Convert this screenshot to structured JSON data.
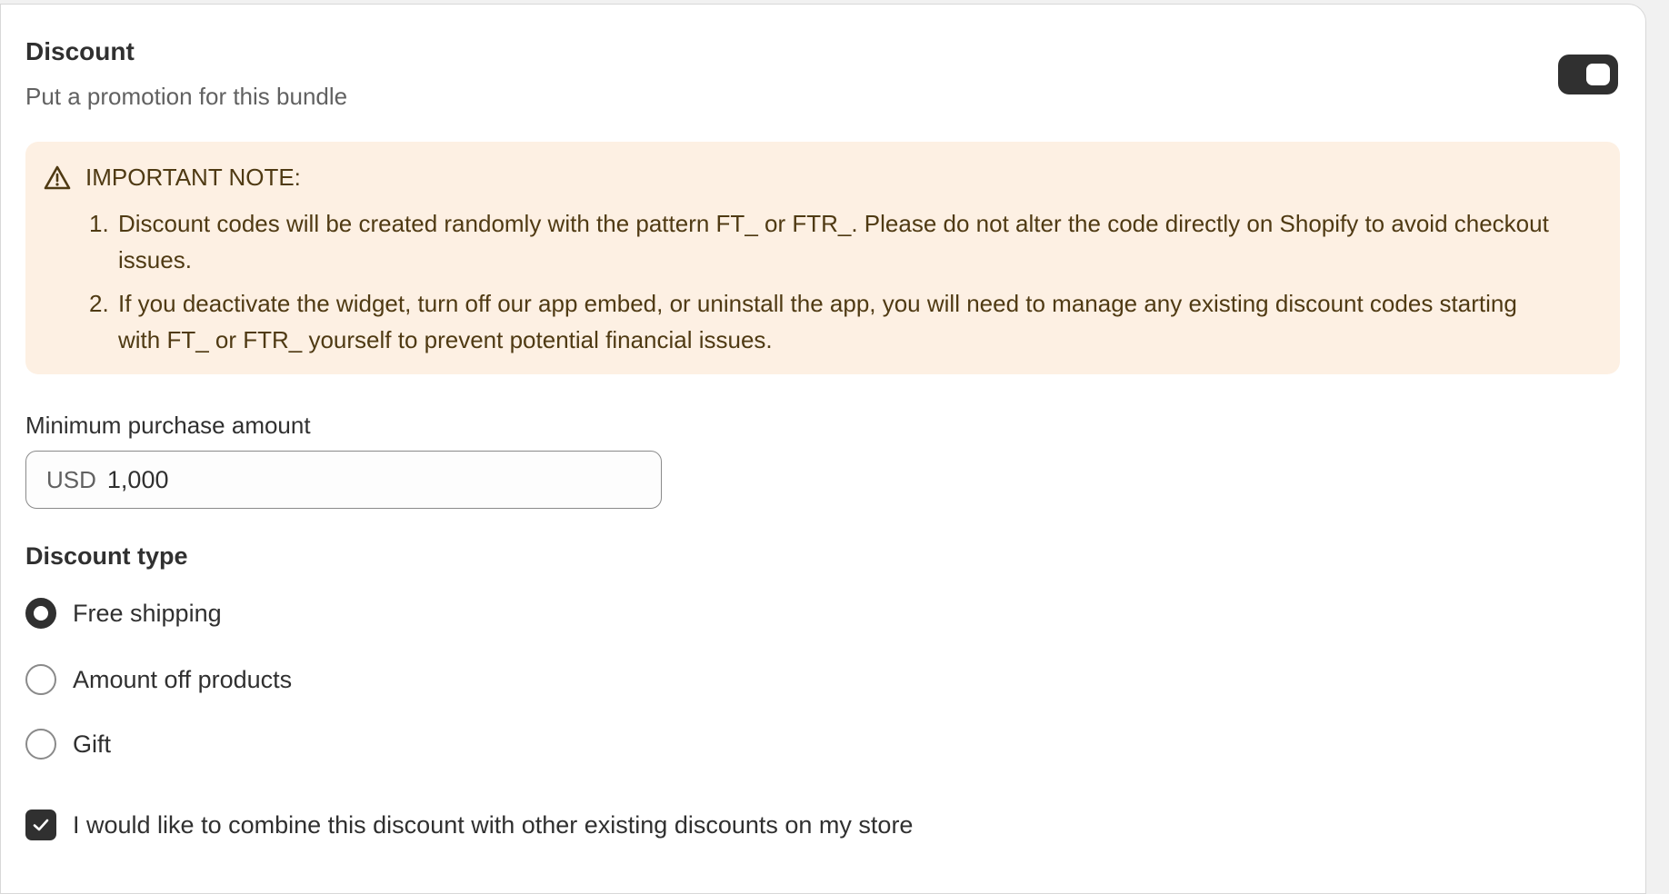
{
  "discount": {
    "title": "Discount",
    "subtitle": "Put a promotion for this bundle",
    "enabled": true
  },
  "note": {
    "title": "IMPORTANT NOTE:",
    "items": [
      {
        "number": "1.",
        "text": "Discount codes will be created randomly with the pattern FT_ or FTR_. Please do not alter the code directly on Shopify to avoid checkout issues."
      },
      {
        "number": "2.",
        "text": "If you deactivate the widget, turn off our app embed, or uninstall the app, you will need to manage any existing discount codes starting with FT_ or FTR_ yourself to prevent potential financial issues."
      }
    ]
  },
  "minimum": {
    "label": "Minimum purchase amount",
    "currency": "USD",
    "value": "1,000"
  },
  "discount_type": {
    "title": "Discount type",
    "options": [
      {
        "label": "Free shipping",
        "selected": true
      },
      {
        "label": "Amount off products",
        "selected": false
      },
      {
        "label": "Gift",
        "selected": false
      }
    ]
  },
  "combine": {
    "label": "I would like to combine this discount with other existing discounts on my store",
    "checked": true
  },
  "colors": {
    "banner_bg": "#fdf0e3",
    "banner_text": "#4f3a13",
    "primary": "#303030"
  },
  "icons": [
    "warning-triangle-icon",
    "checkmark-icon"
  ]
}
